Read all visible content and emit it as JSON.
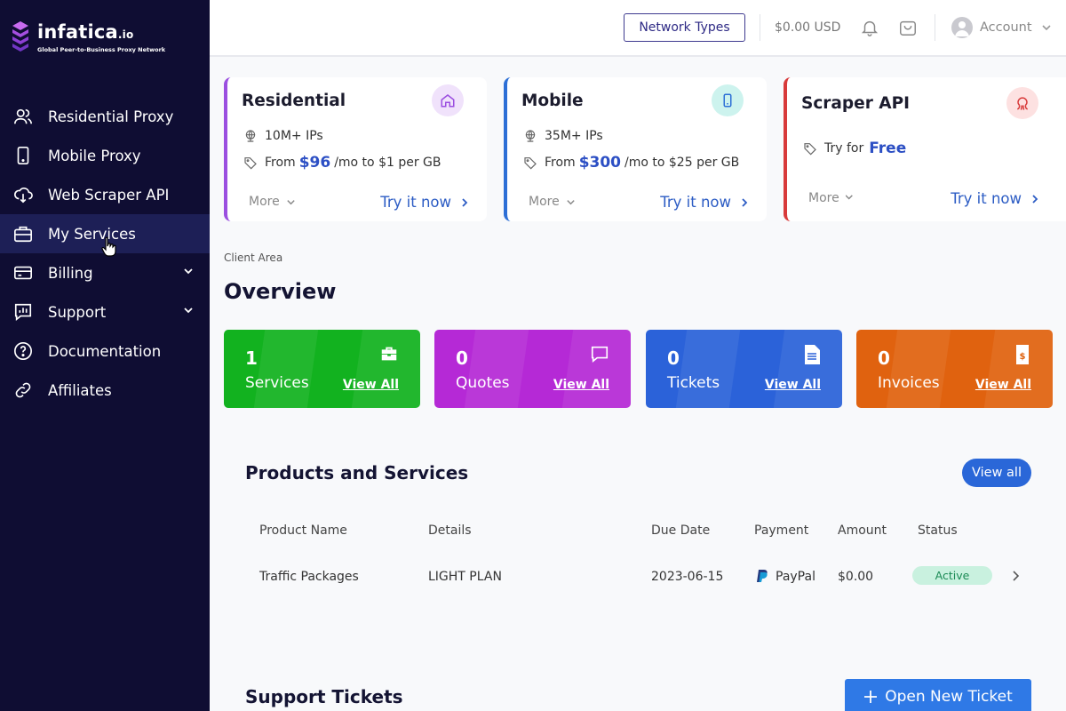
{
  "brand": {
    "name": "infatica",
    "suffix": ".io",
    "tagline": "Global Peer-to-Business Proxy Network"
  },
  "sidebar": {
    "items": [
      {
        "label": "Residential Proxy",
        "icon": "users-icon"
      },
      {
        "label": "Mobile Proxy",
        "icon": "mobile-icon"
      },
      {
        "label": "Web Scraper API",
        "icon": "cloud-download-icon"
      },
      {
        "label": "My Services",
        "icon": "briefcase-icon",
        "active": true
      },
      {
        "label": "Billing",
        "icon": "credit-card-icon",
        "expandable": true
      },
      {
        "label": "Support",
        "icon": "support-chart-icon",
        "expandable": true
      },
      {
        "label": "Documentation",
        "icon": "question-circle-icon"
      },
      {
        "label": "Affiliates",
        "icon": "link-icon"
      }
    ]
  },
  "header": {
    "network_button": "Network Types",
    "balance": "$0.00 USD",
    "account": "Account"
  },
  "products": [
    {
      "title": "Residential",
      "line1": "10M+ IPs",
      "from": "From",
      "price": "$96",
      "rest": "/mo to $1 per GB",
      "more": "More",
      "try": "Try it now",
      "accent": "#9b4fe0"
    },
    {
      "title": "Mobile",
      "line1": "35M+ IPs",
      "from": "From",
      "price": "$300",
      "rest": "/mo to $25 per GB",
      "more": "More",
      "try": "Try it now",
      "accent": "#2d6fd6"
    },
    {
      "title": "Scraper API",
      "try_for": "Try for",
      "free": "Free",
      "more": "More",
      "try": "Try it now",
      "accent": "#d83a3a"
    }
  ],
  "breadcrumb": "Client Area",
  "overview_title": "Overview",
  "stats": [
    {
      "count": "1",
      "label": "Services",
      "link": "View All",
      "color": "#12b21f"
    },
    {
      "count": "0",
      "label": "Quotes",
      "link": "View All",
      "color": "#b529d6"
    },
    {
      "count": "0",
      "label": "Tickets",
      "link": "View All",
      "color": "#2b62d9"
    },
    {
      "count": "0",
      "label": "Invoices",
      "link": "View All",
      "color": "#e0620f"
    }
  ],
  "products_services": {
    "title": "Products and Services",
    "view_all": "View all",
    "headers": [
      "Product Name",
      "Details",
      "Due Date",
      "Payment",
      "Amount",
      "Status"
    ],
    "rows": [
      {
        "product": "Traffic Packages",
        "details": "LIGHT PLAN",
        "due": "2023-06-15",
        "payment": "PayPal",
        "amount": "$0.00",
        "status": "Active"
      }
    ]
  },
  "support_tickets": {
    "title": "Support Tickets",
    "open_button": "Open New Ticket"
  }
}
